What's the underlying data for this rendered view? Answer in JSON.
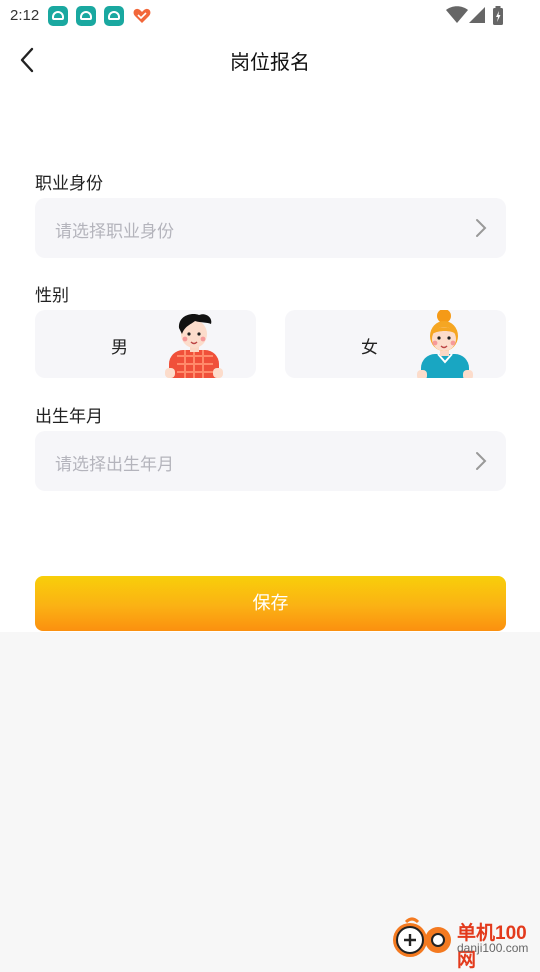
{
  "status_bar": {
    "time": "2:12"
  },
  "header": {
    "title": "岗位报名"
  },
  "occupation": {
    "label": "职业身份",
    "placeholder": "请选择职业身份"
  },
  "gender": {
    "label": "性别",
    "male": "男",
    "female": "女"
  },
  "birth": {
    "label": "出生年月",
    "placeholder": "请选择出生年月"
  },
  "actions": {
    "save": "保存"
  },
  "watermark": {
    "brand": "单机100网",
    "domain": "danji100.com"
  },
  "colors": {
    "accent_top": "#f8cf0a",
    "accent_bottom": "#fb900f",
    "field_bg": "#f6f6f9",
    "placeholder": "#b4b4bc"
  }
}
